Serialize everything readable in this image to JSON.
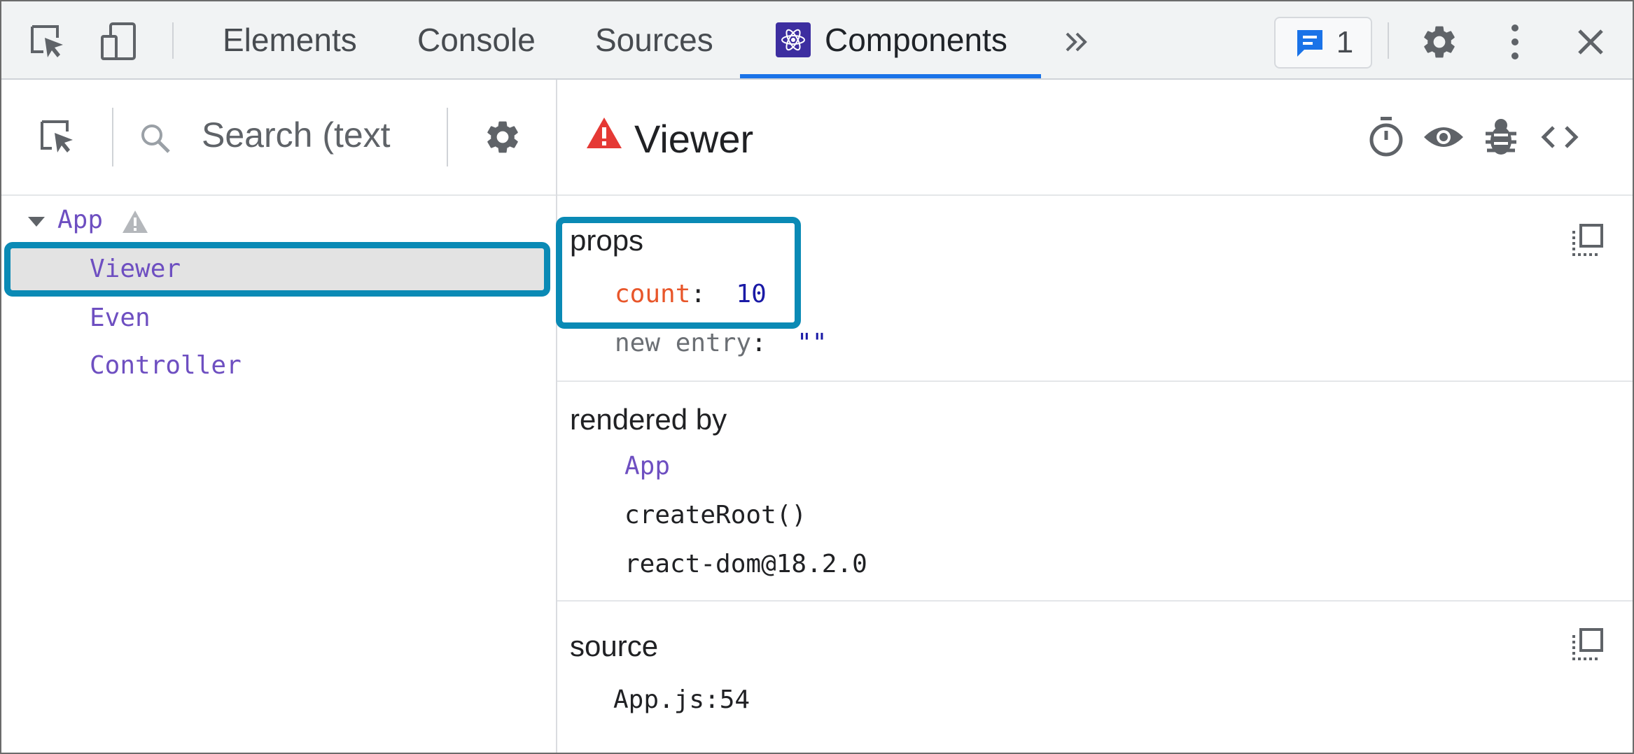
{
  "toolbar": {
    "tabs": [
      "Elements",
      "Console",
      "Sources",
      "Components"
    ],
    "active_tab": "Components",
    "issues_count": "1"
  },
  "left_panel": {
    "search_placeholder": "Search (text",
    "tree": [
      {
        "label": "App",
        "has_warning": true
      },
      {
        "label": "Viewer",
        "selected": true
      },
      {
        "label": "Even"
      },
      {
        "label": "Controller"
      }
    ]
  },
  "right_panel": {
    "component_name": "Viewer",
    "props": {
      "label": "props",
      "entries": [
        {
          "key": "count",
          "sep": ":",
          "value": "10"
        },
        {
          "key": "new entry",
          "sep": ":",
          "value": "\"\""
        }
      ]
    },
    "rendered_by": {
      "label": "rendered by",
      "items": [
        "App",
        "createRoot()",
        "react-dom@18.2.0"
      ]
    },
    "source": {
      "label": "source",
      "value": "App.js:54"
    }
  },
  "colors": {
    "accent_blue": "#1a73e8",
    "highlight_border": "#0a8ab5",
    "component_purple": "#6e4fc1",
    "prop_key_red": "#e8562a",
    "prop_value_navy": "#1a1aa6",
    "warning_red": "#e53935"
  }
}
